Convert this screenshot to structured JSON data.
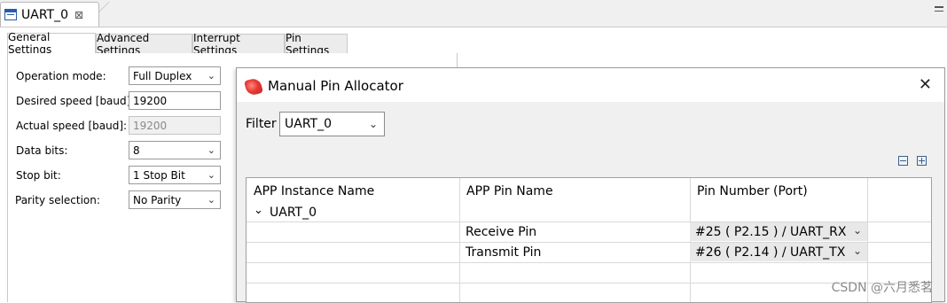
{
  "editor": {
    "tab_title": "UART_0",
    "tab_close_glyph": "⊠"
  },
  "settings": {
    "tabs": [
      "General Settings",
      "Advanced Settings",
      "Interrupt Settings",
      "Pin Settings"
    ],
    "active_tab": "General Settings",
    "fields": {
      "operation_mode": {
        "label": "Operation mode:",
        "value": "Full Duplex"
      },
      "desired_speed": {
        "label": "Desired speed [baud]:",
        "value": "19200"
      },
      "actual_speed": {
        "label": "Actual speed [baud]:",
        "value": "19200"
      },
      "data_bits": {
        "label": "Data bits:",
        "value": "8"
      },
      "stop_bit": {
        "label": "Stop bit:",
        "value": "1 Stop Bit"
      },
      "parity": {
        "label": "Parity selection:",
        "value": "No Parity"
      }
    }
  },
  "dialog": {
    "title": "Manual Pin Allocator",
    "close_glyph": "✕",
    "filter_label": "Filter",
    "filter_value": "UART_0",
    "columns": [
      "APP Instance Name",
      "APP Pin Name",
      "Pin Number (Port)"
    ],
    "instance": {
      "expand_glyph": "⌄",
      "name": "UART_0"
    },
    "rows": [
      {
        "pin_name": "Receive Pin",
        "pin_number": "#25 ( P2.15 ) / UART_RX"
      },
      {
        "pin_name": "Transmit Pin",
        "pin_number": "#26 ( P2.14 ) / UART_TX"
      }
    ]
  },
  "chevron_glyph": "⌄",
  "watermark": "CSDN @六月悉茗",
  "colors": {
    "accent_icon": "#e53935",
    "tab_icon": "#2b5aa8"
  }
}
